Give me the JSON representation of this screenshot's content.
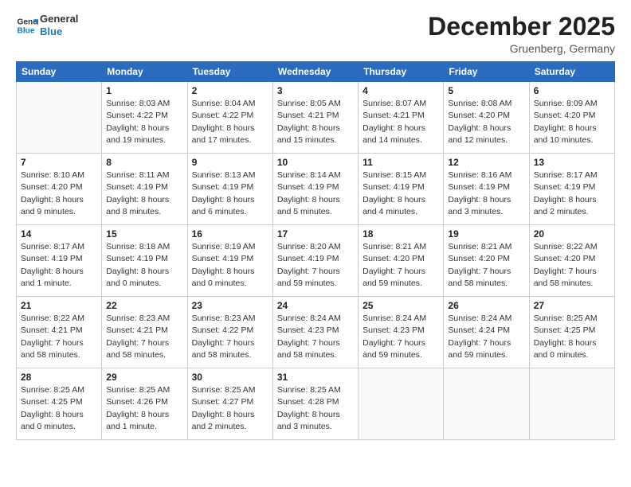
{
  "header": {
    "logo_line1": "General",
    "logo_line2": "Blue",
    "month": "December 2025",
    "location": "Gruenberg, Germany"
  },
  "days_of_week": [
    "Sunday",
    "Monday",
    "Tuesday",
    "Wednesday",
    "Thursday",
    "Friday",
    "Saturday"
  ],
  "weeks": [
    [
      {
        "day": "",
        "sunrise": "",
        "sunset": "",
        "daylight": ""
      },
      {
        "day": "1",
        "sunrise": "Sunrise: 8:03 AM",
        "sunset": "Sunset: 4:22 PM",
        "daylight": "Daylight: 8 hours and 19 minutes."
      },
      {
        "day": "2",
        "sunrise": "Sunrise: 8:04 AM",
        "sunset": "Sunset: 4:22 PM",
        "daylight": "Daylight: 8 hours and 17 minutes."
      },
      {
        "day": "3",
        "sunrise": "Sunrise: 8:05 AM",
        "sunset": "Sunset: 4:21 PM",
        "daylight": "Daylight: 8 hours and 15 minutes."
      },
      {
        "day": "4",
        "sunrise": "Sunrise: 8:07 AM",
        "sunset": "Sunset: 4:21 PM",
        "daylight": "Daylight: 8 hours and 14 minutes."
      },
      {
        "day": "5",
        "sunrise": "Sunrise: 8:08 AM",
        "sunset": "Sunset: 4:20 PM",
        "daylight": "Daylight: 8 hours and 12 minutes."
      },
      {
        "day": "6",
        "sunrise": "Sunrise: 8:09 AM",
        "sunset": "Sunset: 4:20 PM",
        "daylight": "Daylight: 8 hours and 10 minutes."
      }
    ],
    [
      {
        "day": "7",
        "sunrise": "Sunrise: 8:10 AM",
        "sunset": "Sunset: 4:20 PM",
        "daylight": "Daylight: 8 hours and 9 minutes."
      },
      {
        "day": "8",
        "sunrise": "Sunrise: 8:11 AM",
        "sunset": "Sunset: 4:19 PM",
        "daylight": "Daylight: 8 hours and 8 minutes."
      },
      {
        "day": "9",
        "sunrise": "Sunrise: 8:13 AM",
        "sunset": "Sunset: 4:19 PM",
        "daylight": "Daylight: 8 hours and 6 minutes."
      },
      {
        "day": "10",
        "sunrise": "Sunrise: 8:14 AM",
        "sunset": "Sunset: 4:19 PM",
        "daylight": "Daylight: 8 hours and 5 minutes."
      },
      {
        "day": "11",
        "sunrise": "Sunrise: 8:15 AM",
        "sunset": "Sunset: 4:19 PM",
        "daylight": "Daylight: 8 hours and 4 minutes."
      },
      {
        "day": "12",
        "sunrise": "Sunrise: 8:16 AM",
        "sunset": "Sunset: 4:19 PM",
        "daylight": "Daylight: 8 hours and 3 minutes."
      },
      {
        "day": "13",
        "sunrise": "Sunrise: 8:17 AM",
        "sunset": "Sunset: 4:19 PM",
        "daylight": "Daylight: 8 hours and 2 minutes."
      }
    ],
    [
      {
        "day": "14",
        "sunrise": "Sunrise: 8:17 AM",
        "sunset": "Sunset: 4:19 PM",
        "daylight": "Daylight: 8 hours and 1 minute."
      },
      {
        "day": "15",
        "sunrise": "Sunrise: 8:18 AM",
        "sunset": "Sunset: 4:19 PM",
        "daylight": "Daylight: 8 hours and 0 minutes."
      },
      {
        "day": "16",
        "sunrise": "Sunrise: 8:19 AM",
        "sunset": "Sunset: 4:19 PM",
        "daylight": "Daylight: 8 hours and 0 minutes."
      },
      {
        "day": "17",
        "sunrise": "Sunrise: 8:20 AM",
        "sunset": "Sunset: 4:19 PM",
        "daylight": "Daylight: 7 hours and 59 minutes."
      },
      {
        "day": "18",
        "sunrise": "Sunrise: 8:21 AM",
        "sunset": "Sunset: 4:20 PM",
        "daylight": "Daylight: 7 hours and 59 minutes."
      },
      {
        "day": "19",
        "sunrise": "Sunrise: 8:21 AM",
        "sunset": "Sunset: 4:20 PM",
        "daylight": "Daylight: 7 hours and 58 minutes."
      },
      {
        "day": "20",
        "sunrise": "Sunrise: 8:22 AM",
        "sunset": "Sunset: 4:20 PM",
        "daylight": "Daylight: 7 hours and 58 minutes."
      }
    ],
    [
      {
        "day": "21",
        "sunrise": "Sunrise: 8:22 AM",
        "sunset": "Sunset: 4:21 PM",
        "daylight": "Daylight: 7 hours and 58 minutes."
      },
      {
        "day": "22",
        "sunrise": "Sunrise: 8:23 AM",
        "sunset": "Sunset: 4:21 PM",
        "daylight": "Daylight: 7 hours and 58 minutes."
      },
      {
        "day": "23",
        "sunrise": "Sunrise: 8:23 AM",
        "sunset": "Sunset: 4:22 PM",
        "daylight": "Daylight: 7 hours and 58 minutes."
      },
      {
        "day": "24",
        "sunrise": "Sunrise: 8:24 AM",
        "sunset": "Sunset: 4:23 PM",
        "daylight": "Daylight: 7 hours and 58 minutes."
      },
      {
        "day": "25",
        "sunrise": "Sunrise: 8:24 AM",
        "sunset": "Sunset: 4:23 PM",
        "daylight": "Daylight: 7 hours and 59 minutes."
      },
      {
        "day": "26",
        "sunrise": "Sunrise: 8:24 AM",
        "sunset": "Sunset: 4:24 PM",
        "daylight": "Daylight: 7 hours and 59 minutes."
      },
      {
        "day": "27",
        "sunrise": "Sunrise: 8:25 AM",
        "sunset": "Sunset: 4:25 PM",
        "daylight": "Daylight: 8 hours and 0 minutes."
      }
    ],
    [
      {
        "day": "28",
        "sunrise": "Sunrise: 8:25 AM",
        "sunset": "Sunset: 4:25 PM",
        "daylight": "Daylight: 8 hours and 0 minutes."
      },
      {
        "day": "29",
        "sunrise": "Sunrise: 8:25 AM",
        "sunset": "Sunset: 4:26 PM",
        "daylight": "Daylight: 8 hours and 1 minute."
      },
      {
        "day": "30",
        "sunrise": "Sunrise: 8:25 AM",
        "sunset": "Sunset: 4:27 PM",
        "daylight": "Daylight: 8 hours and 2 minutes."
      },
      {
        "day": "31",
        "sunrise": "Sunrise: 8:25 AM",
        "sunset": "Sunset: 4:28 PM",
        "daylight": "Daylight: 8 hours and 3 minutes."
      },
      {
        "day": "",
        "sunrise": "",
        "sunset": "",
        "daylight": ""
      },
      {
        "day": "",
        "sunrise": "",
        "sunset": "",
        "daylight": ""
      },
      {
        "day": "",
        "sunrise": "",
        "sunset": "",
        "daylight": ""
      }
    ]
  ]
}
